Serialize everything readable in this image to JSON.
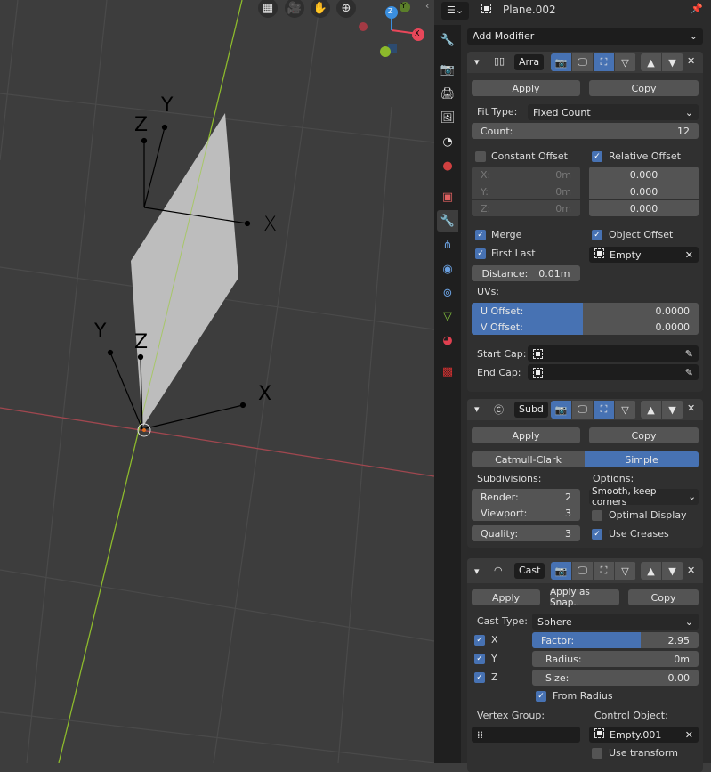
{
  "viewport": {
    "nav_buttons": [
      "grid-icon",
      "camera-icon",
      "hand-icon",
      "zoom-icon"
    ],
    "gizmo": {
      "x": "X",
      "y": "Y",
      "z": "Z"
    },
    "empty_top": {
      "x": "X",
      "y": "Y",
      "z": "Z"
    },
    "empty_bottom": {
      "x": "X",
      "y": "Y",
      "z": "Z"
    }
  },
  "header": {
    "object_name": "Plane.002"
  },
  "add_modifier": "Add Modifier",
  "array": {
    "name": "Arra",
    "apply": "Apply",
    "copy": "Copy",
    "fit_type_label": "Fit Type:",
    "fit_type": "Fixed Count",
    "count_label": "Count:",
    "count": "12",
    "constant_offset": "Constant Offset",
    "relative_offset": "Relative Offset",
    "const_x_label": "X:",
    "const_x": "0m",
    "const_y_label": "Y:",
    "const_y": "0m",
    "const_z_label": "Z:",
    "const_z": "0m",
    "rel_x": "0.000",
    "rel_y": "0.000",
    "rel_z": "0.000",
    "merge": "Merge",
    "first_last": "First Last",
    "object_offset": "Object Offset",
    "offset_object": "Empty",
    "distance_label": "Distance:",
    "distance": "0.01m",
    "uvs_label": "UVs:",
    "u_offset_label": "U Offset:",
    "u_offset": "0.0000",
    "v_offset_label": "V Offset:",
    "v_offset": "0.0000",
    "start_cap": "Start Cap:",
    "end_cap": "End Cap:"
  },
  "subsurf": {
    "name": "Subd",
    "apply": "Apply",
    "copy": "Copy",
    "type_catmull": "Catmull-Clark",
    "type_simple": "Simple",
    "subdivisions_label": "Subdivisions:",
    "options_label": "Options:",
    "render_label": "Render:",
    "render": "2",
    "viewport_label": "Viewport:",
    "viewport": "3",
    "quality_label": "Quality:",
    "quality": "3",
    "uv_smooth": "Smooth, keep corners",
    "optimal_display": "Optimal Display",
    "use_creases": "Use Creases"
  },
  "cast": {
    "name": "Cast",
    "apply": "Apply",
    "apply_shape": "Apply as Snap..",
    "copy": "Copy",
    "cast_type_label": "Cast Type:",
    "cast_type": "Sphere",
    "x": "X",
    "y": "Y",
    "z": "Z",
    "factor_label": "Factor:",
    "factor": "2.95",
    "factor_fill_percent": 65,
    "radius_label": "Radius:",
    "radius": "0m",
    "size_label": "Size:",
    "size": "0.00",
    "from_radius": "From Radius",
    "vertex_group_label": "Vertex Group:",
    "control_object_label": "Control Object:",
    "control_object": "Empty.001",
    "use_transform": "Use transform"
  },
  "colors": {
    "accent": "#4772b3",
    "x_axis": "#e8475a",
    "y_axis": "#8cb92b",
    "z_axis": "#3a8fe0"
  }
}
